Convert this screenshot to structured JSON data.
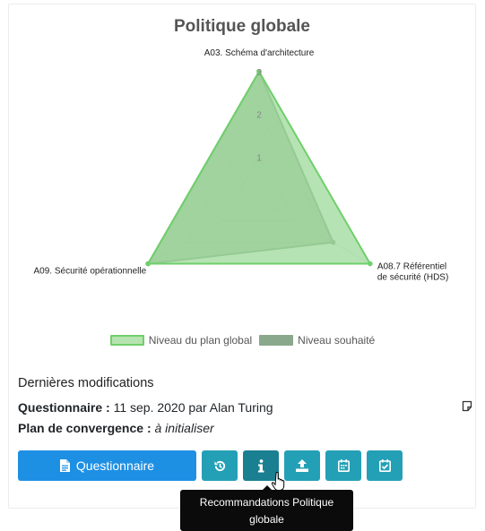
{
  "card": {
    "title": "Politique globale"
  },
  "chart_data": {
    "type": "radar",
    "title": "Politique globale",
    "axes": [
      "A03. Schéma d'architecture",
      "A08.7 Référentiel de sécurité (HDS)",
      "A09. Sécurité opérationnelle"
    ],
    "axis_label_lines": [
      [
        "A03. Schéma d'architecture"
      ],
      [
        "A08.7 Référentiel",
        "de sécurité (HDS)"
      ],
      [
        "A09. Sécurité opérationnelle"
      ]
    ],
    "rmax": 3,
    "ticks": [
      "1",
      "2",
      "3"
    ],
    "series": [
      {
        "name": "Niveau du plan global",
        "values": [
          3,
          3,
          3
        ],
        "fill": "#9ed99a",
        "stroke": "#6fcf6b",
        "opacity": 0.75
      },
      {
        "name": "Niveau souhaité",
        "values": [
          3,
          2,
          3
        ],
        "fill": "#8aa88c",
        "stroke": "#7d9a80",
        "opacity": 0.75
      }
    ],
    "legend_position": "bottom"
  },
  "modifications": {
    "heading": "Dernières modifications",
    "questionnaire_label": "Questionnaire :",
    "questionnaire_value": "11 sep. 2020 par Alan Turing",
    "plan_label": "Plan de convergence :",
    "plan_value": "à initialiser"
  },
  "actions": {
    "questionnaire_button": "Questionnaire"
  },
  "tooltip": {
    "line1": "Recommandations Politique",
    "line2": "globale"
  },
  "colors": {
    "primary": "#1e90e4",
    "teal": "#24a0b6",
    "teal_active": "#1a7f91"
  }
}
